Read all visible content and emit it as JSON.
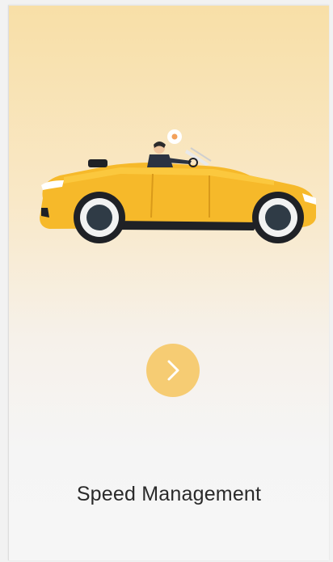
{
  "card": {
    "title": "Speed Management",
    "illustration_icon": "convertible-car-icon",
    "next_icon": "chevron-right-icon",
    "accent_color": "#f6cc73",
    "background_top": "#f8dfa7",
    "background_bottom": "#f6f6f6"
  }
}
